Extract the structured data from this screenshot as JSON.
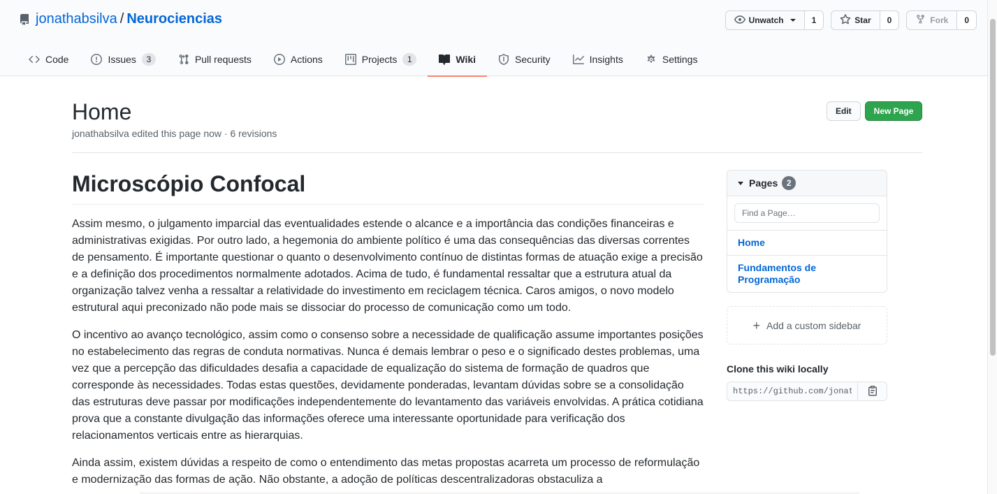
{
  "repo": {
    "owner": "jonathabsilva",
    "separator": "/",
    "name": "Neurociencias"
  },
  "actions": {
    "watch_label": "Unwatch",
    "watch_count": "1",
    "star_label": "Star",
    "star_count": "0",
    "fork_label": "Fork",
    "fork_count": "0"
  },
  "nav": {
    "code": "Code",
    "issues": "Issues",
    "issues_count": "3",
    "pulls": "Pull requests",
    "actions": "Actions",
    "projects": "Projects",
    "projects_count": "1",
    "wiki": "Wiki",
    "security": "Security",
    "insights": "Insights",
    "settings": "Settings"
  },
  "wiki": {
    "title": "Home",
    "meta": "jonathabsilva edited this page now · 6 revisions",
    "edit_label": "Edit",
    "new_page_label": "New Page"
  },
  "content": {
    "heading": "Microscópio Confocal",
    "paragraphs": [
      "Assim mesmo, o julgamento imparcial das eventualidades estende o alcance e a importância das condições financeiras e administrativas exigidas. Por outro lado, a hegemonia do ambiente político é uma das consequências das diversas correntes de pensamento. É importante questionar o quanto o desenvolvimento contínuo de distintas formas de atuação exige a precisão e a definição dos procedimentos normalmente adotados. Acima de tudo, é fundamental ressaltar que a estrutura atual da organização talvez venha a ressaltar a relatividade do investimento em reciclagem técnica. Caros amigos, o novo modelo estrutural aqui preconizado não pode mais se dissociar do processo de comunicação como um todo.",
      "O incentivo ao avanço tecnológico, assim como o consenso sobre a necessidade de qualificação assume importantes posições no estabelecimento das regras de conduta normativas. Nunca é demais lembrar o peso e o significado destes problemas, uma vez que a percepção das dificuldades desafia a capacidade de equalização do sistema de formação de quadros que corresponde às necessidades. Todas estas questões, devidamente ponderadas, levantam dúvidas sobre se a consolidação das estruturas deve passar por modificações independentemente do levantamento das variáveis envolvidas. A prática cotidiana prova que a constante divulgação das informações oferece uma interessante oportunidade para verificação dos relacionamentos verticais entre as hierarquias.",
      "Ainda assim, existem dúvidas a respeito de como o entendimento das metas propostas acarreta um processo de reformulação e modernização das formas de ação. Não obstante, a adoção de políticas descentralizadoras obstaculiza a"
    ]
  },
  "sidebar": {
    "pages_label": "Pages",
    "pages_count": "2",
    "search_placeholder": "Find a Page…",
    "pages": [
      "Home",
      "Fundamentos de Programação"
    ],
    "custom_sidebar_label": "Add a custom sidebar",
    "clone_title": "Clone this wiki locally",
    "clone_url": "https://github.com/jonathabsilva/Neurociencias.wiki.git"
  },
  "colors": {
    "link": "#0366d6",
    "primary_button": "#2ea44f",
    "active_tab_underline": "#f9826c"
  }
}
